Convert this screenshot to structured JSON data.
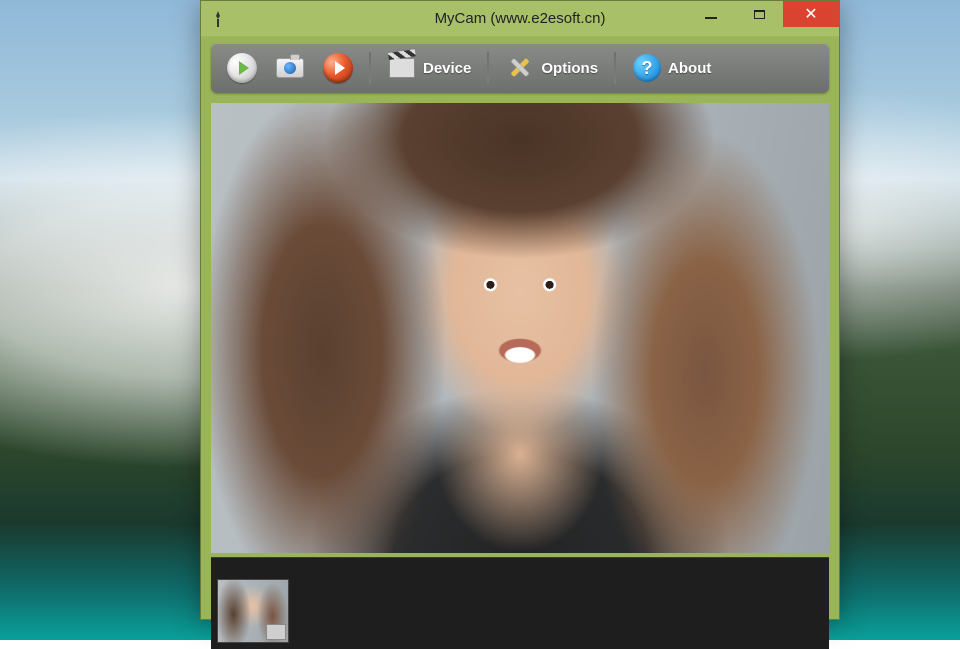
{
  "window": {
    "title": "MyCam (www.e2esoft.cn)"
  },
  "toolbar": {
    "play_label": "",
    "snapshot_label": "",
    "record_label": "",
    "device_label": "Device",
    "options_label": "Options",
    "about_label": "About"
  },
  "icons": {
    "play": "play-icon",
    "camera": "camera-icon",
    "record": "record-icon",
    "clapper": "clapperboard-icon",
    "tools": "tools-icon",
    "help": "help-icon"
  },
  "colors": {
    "window_chrome": "#a8c168",
    "close_button": "#d9432f",
    "toolbar_bg": "#7b7d7b"
  }
}
